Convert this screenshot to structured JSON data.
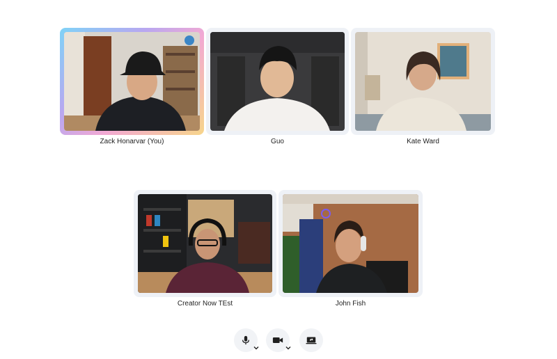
{
  "participants": [
    {
      "name": "Zack Honarvar (You)",
      "speaking": true
    },
    {
      "name": "Guo",
      "speaking": false
    },
    {
      "name": "Kate Ward",
      "speaking": false
    },
    {
      "name": "Creator Now TEst",
      "speaking": false
    },
    {
      "name": "John Fish",
      "speaking": false
    }
  ],
  "controls": {
    "mic_icon": "microphone-icon",
    "camera_icon": "video-camera-icon",
    "share_icon": "screen-share-icon"
  },
  "colors": {
    "tile_bg": "#eef1f6",
    "control_bg": "#f1f3f6",
    "icon": "#1f1f1f"
  }
}
